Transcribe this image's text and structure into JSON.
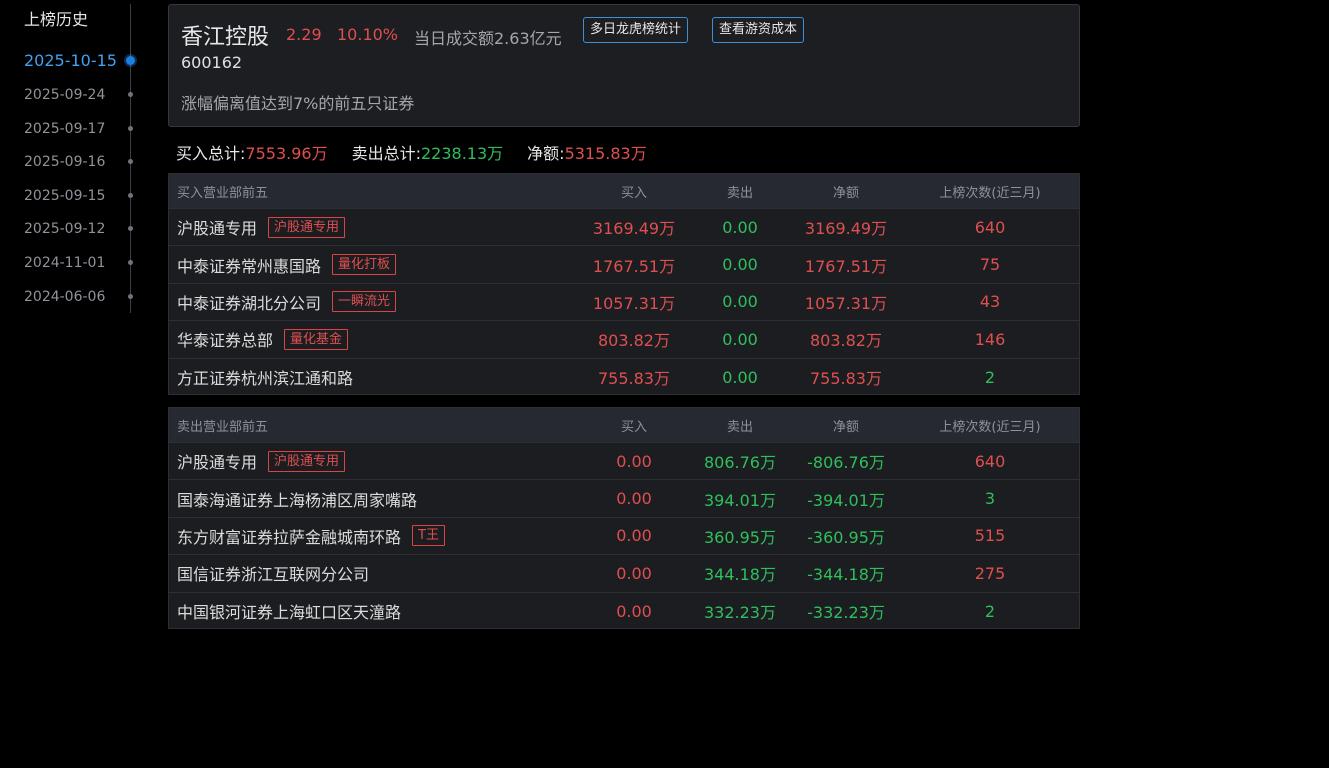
{
  "history": {
    "title": "上榜历史",
    "dates": [
      "2025-10-15",
      "2025-09-24",
      "2025-09-17",
      "2025-09-16",
      "2025-09-15",
      "2025-09-12",
      "2024-11-01",
      "2024-06-06"
    ],
    "active_index": 0
  },
  "stock": {
    "name": "香江控股",
    "price": "2.29",
    "change_pct": "10.10%",
    "turnover": "当日成交额2.63亿元",
    "code": "600162",
    "reason": "涨幅偏离值达到7%的前五只证券",
    "btn_multiday": "多日龙虎榜统计",
    "btn_cost": "查看游资成本"
  },
  "totals": {
    "buy_label": "买入总计:",
    "buy_value": "7553.96万",
    "sell_label": "卖出总计:",
    "sell_value": "2238.13万",
    "net_label": "净额:",
    "net_value": "5315.83万"
  },
  "columns": {
    "buy": "买入",
    "sell": "卖出",
    "net": "净额",
    "times": "上榜次数(近三月)"
  },
  "buy_table": {
    "header": "买入营业部前五",
    "rows": [
      {
        "name": "沪股通专用",
        "tag": "沪股通专用",
        "buy": "3169.49万",
        "sell": "0.00",
        "net": "3169.49万",
        "times": "640",
        "times_color": "red"
      },
      {
        "name": "中泰证券常州惠国路",
        "tag": "量化打板",
        "buy": "1767.51万",
        "sell": "0.00",
        "net": "1767.51万",
        "times": "75",
        "times_color": "red"
      },
      {
        "name": "中泰证券湖北分公司",
        "tag": "一瞬流光",
        "buy": "1057.31万",
        "sell": "0.00",
        "net": "1057.31万",
        "times": "43",
        "times_color": "red"
      },
      {
        "name": "华泰证券总部",
        "tag": "量化基金",
        "buy": "803.82万",
        "sell": "0.00",
        "net": "803.82万",
        "times": "146",
        "times_color": "red"
      },
      {
        "name": "方正证券杭州滨江通和路",
        "tag": "",
        "buy": "755.83万",
        "sell": "0.00",
        "net": "755.83万",
        "times": "2",
        "times_color": "green"
      }
    ]
  },
  "sell_table": {
    "header": "卖出营业部前五",
    "rows": [
      {
        "name": "沪股通专用",
        "tag": "沪股通专用",
        "buy": "0.00",
        "sell": "806.76万",
        "net": "-806.76万",
        "times": "640",
        "times_color": "red"
      },
      {
        "name": "国泰海通证券上海杨浦区周家嘴路",
        "tag": "",
        "buy": "0.00",
        "sell": "394.01万",
        "net": "-394.01万",
        "times": "3",
        "times_color": "green"
      },
      {
        "name": "东方财富证券拉萨金融城南环路",
        "tag": "T王",
        "buy": "0.00",
        "sell": "360.95万",
        "net": "-360.95万",
        "times": "515",
        "times_color": "red"
      },
      {
        "name": "国信证券浙江互联网分公司",
        "tag": "",
        "buy": "0.00",
        "sell": "344.18万",
        "net": "-344.18万",
        "times": "275",
        "times_color": "red"
      },
      {
        "name": "中国银河证券上海虹口区天潼路",
        "tag": "",
        "buy": "0.00",
        "sell": "332.23万",
        "net": "-332.23万",
        "times": "2",
        "times_color": "green"
      }
    ]
  },
  "colors": {
    "accent_blue": "#3ea1f2",
    "up_red": "#e04f4f",
    "down_green": "#2fbf5b",
    "panel_bg": "#1c1e22",
    "page_bg": "#000000"
  }
}
